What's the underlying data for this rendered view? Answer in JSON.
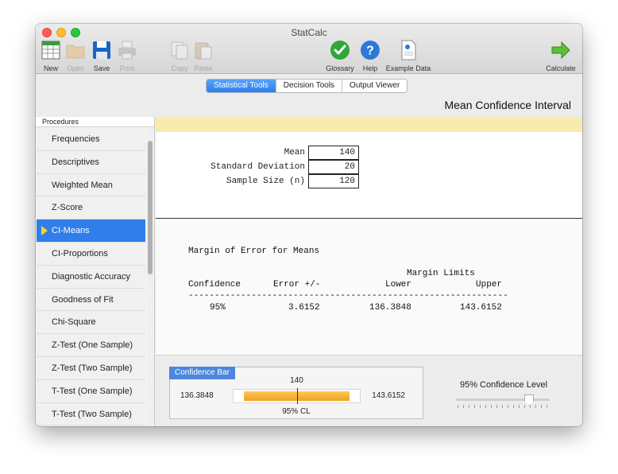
{
  "window": {
    "title": "StatCalc"
  },
  "toolbar": {
    "new": "New",
    "open": "Open",
    "save": "Save",
    "print": "Print",
    "copy": "Copy",
    "paste": "Paste",
    "glossary": "Glossary",
    "help": "Help",
    "example": "Example Data",
    "calculate": "Calculate"
  },
  "tabs": [
    "Statistical Tools",
    "Decision Tools",
    "Output Viewer"
  ],
  "panel_title": "Mean Confidence Interval",
  "sidebar": {
    "header": "Procedures",
    "items": [
      "Frequencies",
      "Descriptives",
      "Weighted Mean",
      "Z-Score",
      "CI-Means",
      "CI-Proportions",
      "Diagnostic Accuracy",
      "Goodness of Fit",
      "Chi-Square",
      "Z-Test (One Sample)",
      "Z-Test (Two Sample)",
      "T-Test (One Sample)",
      "T-Test (Two Sample)"
    ],
    "selected": "CI-Means"
  },
  "inputs": {
    "mean_label": "Mean",
    "mean_value": "140",
    "sd_label": "Standard Deviation",
    "sd_value": "20",
    "n_label": "Sample Size (n)",
    "n_value": "120"
  },
  "output": {
    "heading": "Margin of Error for Means",
    "limits_header": "Margin Limits",
    "col_confidence": "Confidence",
    "col_error": "Error +/-",
    "col_lower": "Lower",
    "col_upper": "Upper",
    "divider": "-------------------------------------------------------------",
    "row": {
      "confidence": "95%",
      "error": "3.6152",
      "lower": "136.3848",
      "upper": "143.6152"
    }
  },
  "confidence_bar": {
    "label": "Confidence Bar",
    "center": "140",
    "lower": "136.3848",
    "upper": "143.6152",
    "cl_text": "95% CL",
    "fill_start": 0.08,
    "fill_end": 0.92
  },
  "confidence_level": {
    "label": "95% Confidence Level",
    "value": 0.78
  }
}
